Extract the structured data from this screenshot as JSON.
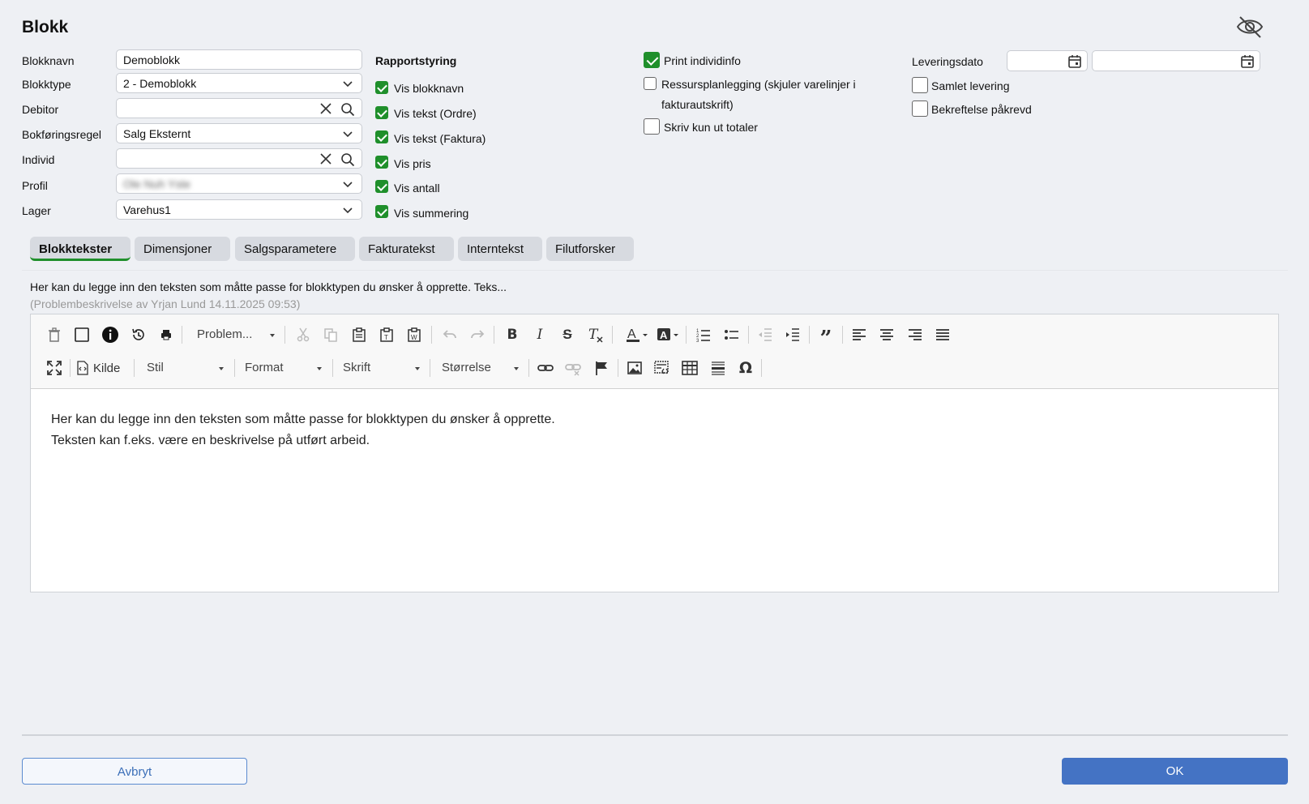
{
  "dialog": {
    "title": "Blokk"
  },
  "form": {
    "blokknavn": {
      "label": "Blokknavn",
      "value": "Demoblokk"
    },
    "blokktype": {
      "label": "Blokktype",
      "value": "2 - Demoblokk"
    },
    "debitor": {
      "label": "Debitor",
      "value": ""
    },
    "bokforingsregel": {
      "label": "Bokføringsregel",
      "value": "Salg Eksternt"
    },
    "individ": {
      "label": "Individ",
      "value": ""
    },
    "profil": {
      "label": "Profil",
      "value": "Ole Nuh Yste"
    },
    "lager": {
      "label": "Lager",
      "value": "Varehus1"
    }
  },
  "rapportstyring": {
    "heading": "Rapportstyring",
    "items": [
      {
        "label": "Vis blokknavn",
        "checked": true
      },
      {
        "label": "Vis tekst (Ordre)",
        "checked": true
      },
      {
        "label": "Vis tekst (Faktura)",
        "checked": true
      },
      {
        "label": "Vis pris",
        "checked": true
      },
      {
        "label": "Vis antall",
        "checked": true
      },
      {
        "label": "Vis summering",
        "checked": true
      }
    ]
  },
  "options": {
    "print_individinfo": {
      "label": "Print individinfo",
      "checked": true
    },
    "ressursplanlegging": {
      "label_line1": "Ressursplanlegging (skjuler varelinjer i",
      "label_line2": "fakturautskrift)",
      "checked": false
    },
    "skriv_totaler": {
      "label": "Skriv kun ut totaler",
      "checked": false
    }
  },
  "delivery": {
    "leveringsdato_label": "Leveringsdato",
    "date_from": "",
    "date_to": "",
    "samlet_levering": {
      "label": "Samlet levering",
      "checked": false
    },
    "bekreftelse": {
      "label": "Bekreftelse påkrevd",
      "checked": false
    }
  },
  "tabs": [
    {
      "label": "Blokktekster",
      "active": true
    },
    {
      "label": "Dimensjoner"
    },
    {
      "label": "Salgsparametere"
    },
    {
      "label": "Fakturatekst"
    },
    {
      "label": "Interntekst"
    },
    {
      "label": "Filutforsker"
    }
  ],
  "description": {
    "preview": "Her kan du legge inn den teksten som måtte passe for blokktypen du ønsker å opprette. Teks...",
    "meta": "(Problembeskrivelse av Yrjan Lund 14.11.2025 09:53)"
  },
  "toolbar": {
    "template_combo": "Problem...",
    "source_label": "Kilde",
    "style_combo": "Stil",
    "format_combo": "Format",
    "font_combo": "Skrift",
    "size_combo": "Størrelse"
  },
  "editor": {
    "line1": "Her kan du legge inn den teksten som måtte passe for blokktypen du ønsker å opprette.",
    "line2": "Teksten kan f.eks. være en beskrivelse på utført arbeid."
  },
  "buttons": {
    "cancel": "Avbryt",
    "ok": "OK"
  },
  "colors": {
    "check": "#1f8f2b",
    "primary": "#4473c4"
  }
}
